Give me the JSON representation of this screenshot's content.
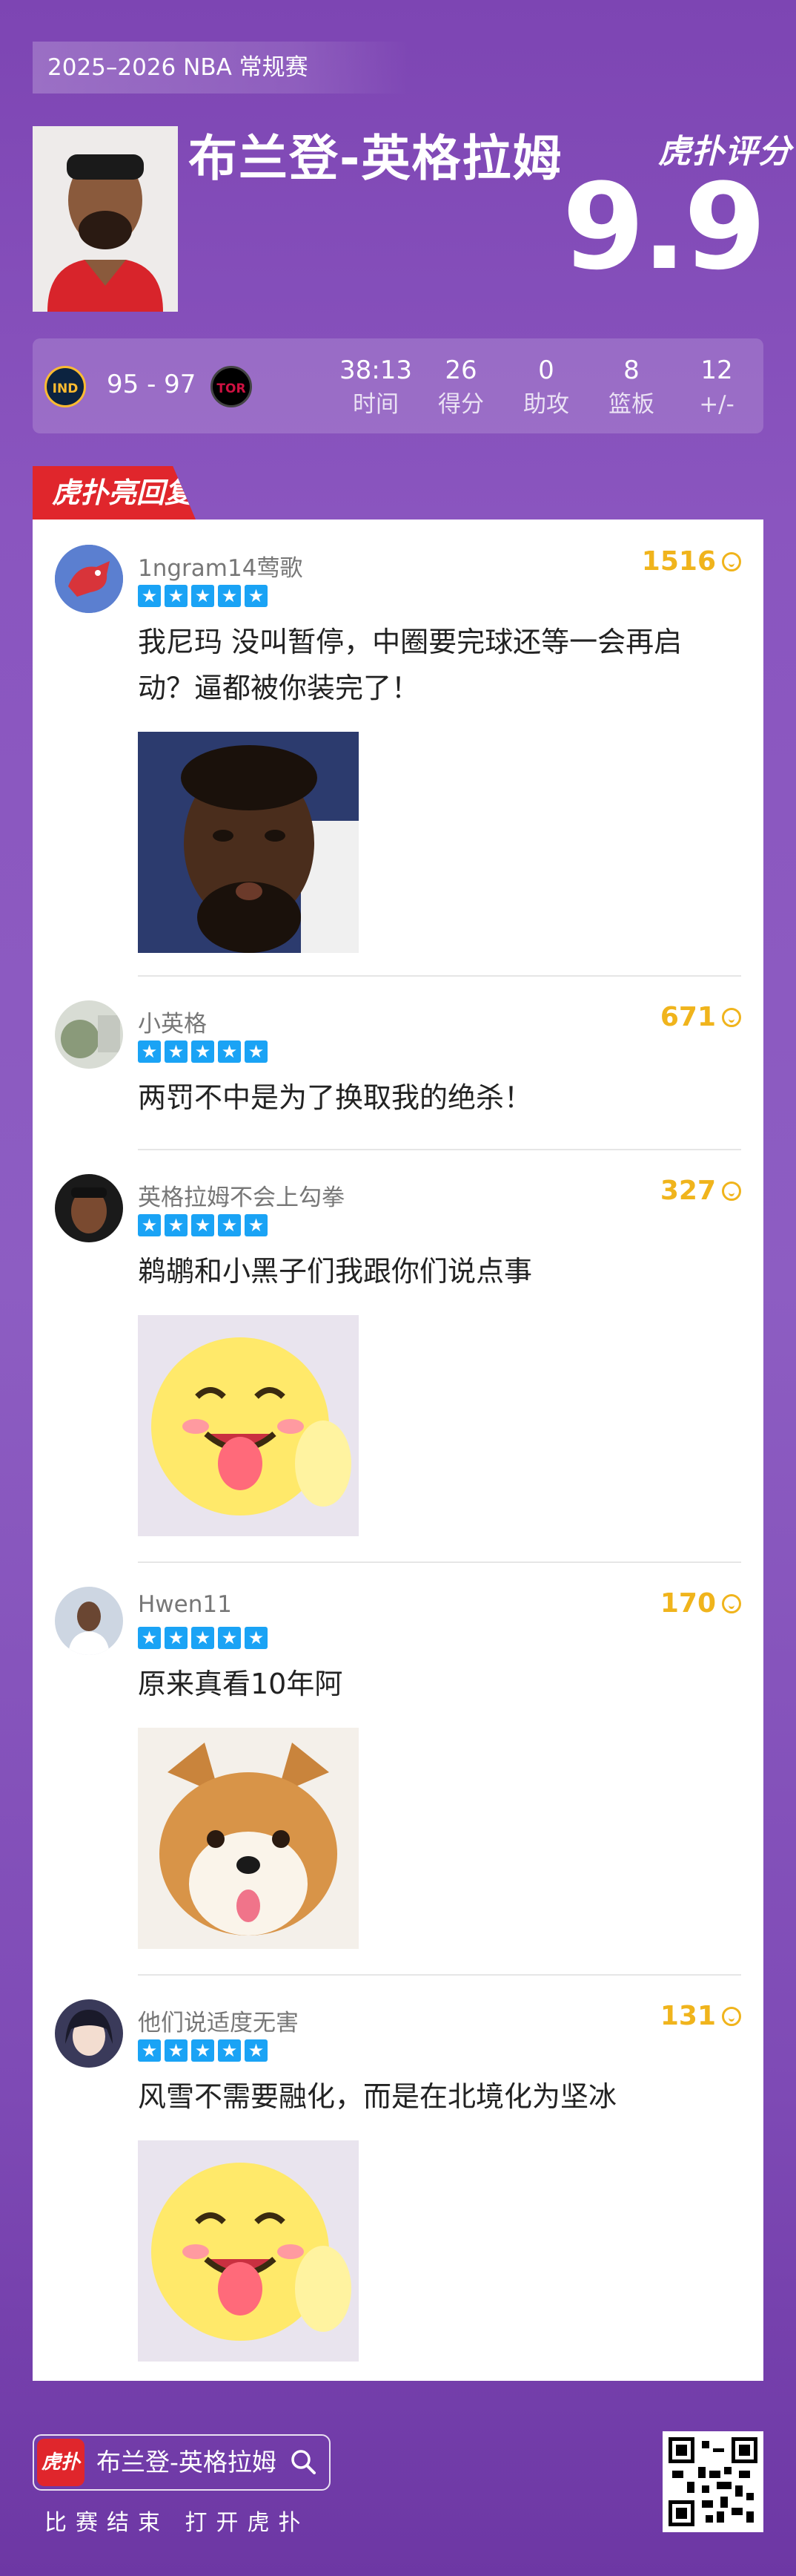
{
  "header": {
    "season": "2025–2026 NBA 常规赛",
    "player_name": "布兰登-英格拉姆",
    "brand": "虎扑评分",
    "rating": "9.9"
  },
  "game": {
    "home_team_icon": "pacers-logo",
    "away_team_icon": "raptors-logo",
    "home_abbr": "IND",
    "away_abbr": "TOR",
    "score": "95 - 97",
    "stats": [
      {
        "value": "38:13",
        "label": "时间"
      },
      {
        "value": "26",
        "label": "得分"
      },
      {
        "value": "0",
        "label": "助攻"
      },
      {
        "value": "8",
        "label": "篮板"
      },
      {
        "value": "12",
        "label": "+/-"
      }
    ]
  },
  "section_title": "虎扑亮回复",
  "comments": [
    {
      "user": "1ngram14莺歌",
      "likes": "1516",
      "stars": 5,
      "text": "我尼玛 没叫暂停，中圈要完球还等一会再启动？逼都被你装完了！",
      "has_image": true
    },
    {
      "user": "小英格",
      "likes": "671",
      "stars": 5,
      "text": "两罚不中是为了换取我的绝杀！",
      "has_image": false
    },
    {
      "user": "英格拉姆不会上勾拳",
      "likes": "327",
      "stars": 5,
      "text": "鹈鹕和小黑子们我跟你们说点事",
      "has_image": true
    },
    {
      "user": "Hwen11",
      "likes": "170",
      "stars": 5,
      "text": "原来真看10年阿",
      "has_image": true
    },
    {
      "user": "他们说适度无害",
      "likes": "131",
      "stars": 5,
      "text": "风雪不需要融化，而是在北境化为坚冰",
      "has_image": true
    }
  ],
  "footer": {
    "app_icon_text": "虎扑",
    "search_text": "布兰登-英格拉姆",
    "slogan": "比赛结束 打开虎扑"
  },
  "colors": {
    "accent_red": "#e0262c",
    "star_blue": "#1aa3f5",
    "likes_gold": "#f0b41c",
    "bg_purple": "#8a55bf"
  }
}
